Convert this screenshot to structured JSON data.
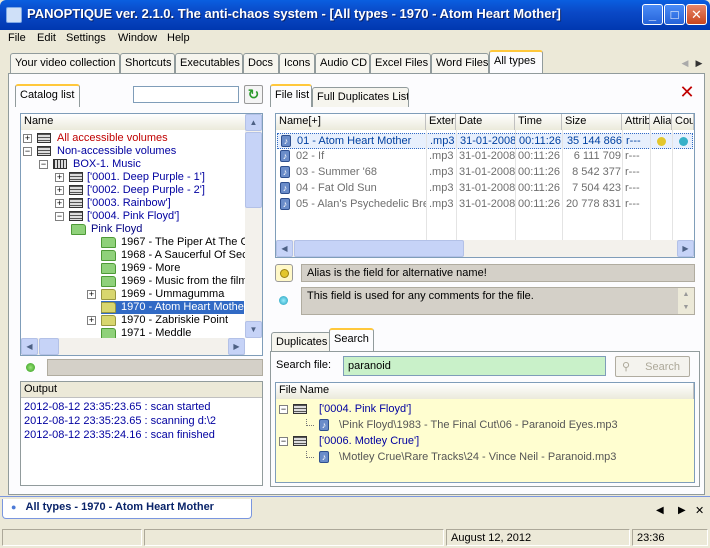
{
  "window": {
    "title": "PANOPTIQUE ver. 2.1.0. The anti-chaos system - [All types - 1970 - Atom Heart Mother]",
    "minimize": "_",
    "maximize": "□",
    "close": "✕"
  },
  "menu": [
    "File",
    "Edit",
    "Settings",
    "Window",
    "Help"
  ],
  "top_tabs": [
    "Your video collection",
    "Shortcuts",
    "Executables",
    "Docs",
    "Icons",
    "Audio CD",
    "Excel Files",
    "Word Files",
    "All types"
  ],
  "tab_scroll": {
    "left": "◀",
    "right": "▶"
  },
  "catalog": {
    "tab_label": "Catalog list",
    "search_value": "",
    "tree_header": "Name",
    "tree": [
      {
        "label": "All accessible volumes",
        "color": "#c00000"
      },
      {
        "label": "Non-accessible volumes",
        "color": "#0000a0"
      },
      {
        "label": "BOX-1. Music",
        "color": "#0000a0"
      },
      {
        "label": "['0001. Deep Purple - 1']",
        "color": "#0000a0"
      },
      {
        "label": "['0002. Deep Purple - 2']",
        "color": "#0000a0"
      },
      {
        "label": "['0003. Rainbow']",
        "color": "#0000a0"
      },
      {
        "label": "['0004. Pink Floyd']",
        "color": "#0000a0"
      },
      {
        "label": "Pink Floyd",
        "color": "#000080"
      },
      {
        "label": "1967 - The Piper At The G",
        "color": "#000"
      },
      {
        "label": "1968 - A Saucerful Of Sec",
        "color": "#000"
      },
      {
        "label": "1969 - More",
        "color": "#000"
      },
      {
        "label": "1969 - Music from the film",
        "color": "#000"
      },
      {
        "label": "1969 - Ummagumma",
        "color": "#000"
      },
      {
        "label": "1970 - Atom Heart Mother",
        "color": "#fff"
      },
      {
        "label": "1970 - Zabriskie Point",
        "color": "#000"
      },
      {
        "label": "1971 - Meddle",
        "color": "#000"
      }
    ]
  },
  "output": {
    "header": "Output",
    "lines": [
      "2012-08-12 23:35:23.65 : scan started",
      "2012-08-12 23:35:23.65 : scanning d:\\2",
      "2012-08-12 23:35:24.16 : scan finished"
    ]
  },
  "file_list": {
    "tabs": [
      "File list",
      "Full Duplicates List"
    ],
    "columns": [
      "Name[+]",
      "Exter",
      "Date",
      "Time",
      "Size",
      "Attrib",
      "Alia",
      "Cou"
    ],
    "rows": [
      {
        "name": "01 - Atom Heart Mother",
        "ext": ".mp3",
        "date": "31-01-2008",
        "time": "00:11:26",
        "size": "35 144 866",
        "attr": "r---"
      },
      {
        "name": "02 - If",
        "ext": ".mp3",
        "date": "31-01-2008",
        "time": "00:11:26",
        "size": "6 111 709",
        "attr": "r---"
      },
      {
        "name": "03 - Summer '68",
        "ext": ".mp3",
        "date": "31-01-2008",
        "time": "00:11:26",
        "size": "8 542 377",
        "attr": "r---"
      },
      {
        "name": "04 - Fat Old Sun",
        "ext": ".mp3",
        "date": "31-01-2008",
        "time": "00:11:26",
        "size": "7 504 423",
        "attr": "r---"
      },
      {
        "name": "05 - Alan's Psychedelic Bre",
        "ext": ".mp3",
        "date": "31-01-2008",
        "time": "00:11:26",
        "size": "20 778 831",
        "attr": "r---"
      }
    ],
    "alias_text": "Alias is the field for alternative name!",
    "comment_text": "This field is used for any comments for the file."
  },
  "search": {
    "tabs": [
      "Duplicates",
      "Search"
    ],
    "label": "Search file:",
    "value": "paranoid",
    "button": "Search",
    "results_header": "File Name",
    "groups": [
      {
        "title": "['0004. Pink Floyd']",
        "item": "\\Pink Floyd\\1983 - The Final Cut\\06 - Paranoid Eyes.mp3"
      },
      {
        "title": "['0006. Motley Crue']",
        "item": "\\Motley Crue\\Rare Tracks\\24 - Vince Neil - Paranoid.mp3"
      }
    ]
  },
  "bottom_tab": "All types - 1970 - Atom Heart Mother",
  "bottom_nav": {
    "prev": "◀",
    "next": "▶",
    "close": "✕"
  },
  "status": {
    "date": "August 12, 2012",
    "time": "23:36"
  },
  "colors": {
    "titlebar": "#0a49c7",
    "selection": "#316ac5",
    "highlight": "#fffed0"
  }
}
